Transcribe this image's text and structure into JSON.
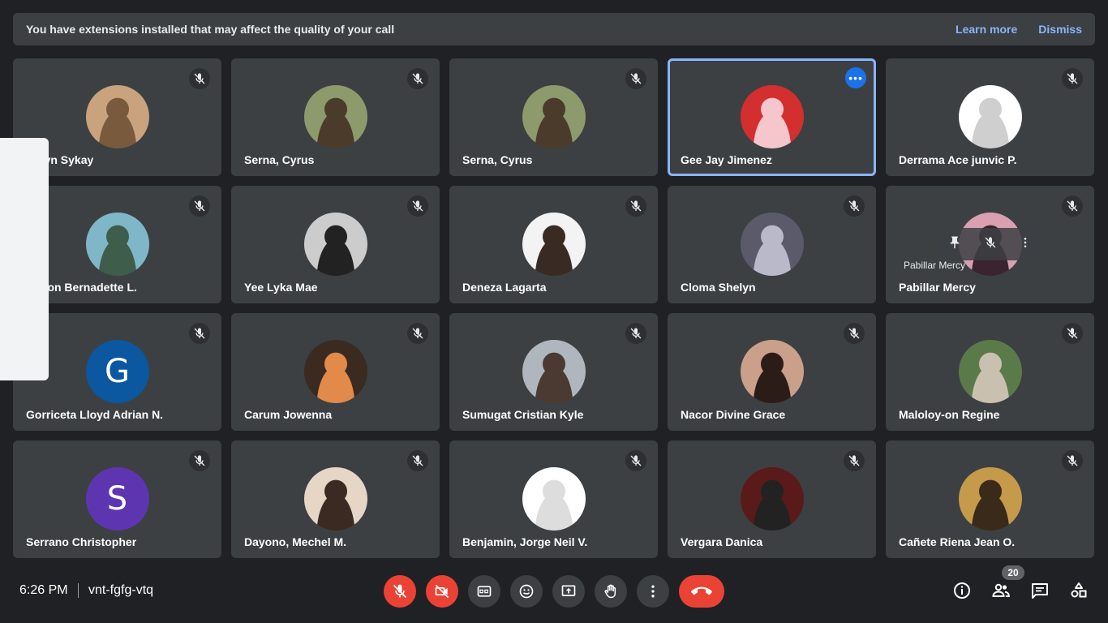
{
  "banner": {
    "message": "You have extensions installed that may affect the quality of your call",
    "learn_more": "Learn more",
    "dismiss": "Dismiss"
  },
  "participants": [
    {
      "name": "Gelyn Sykay",
      "avatar": "photo",
      "muted": true
    },
    {
      "name": "Serna, Cyrus",
      "avatar": "photo",
      "muted": true
    },
    {
      "name": "Serna, Cyrus",
      "avatar": "photo",
      "muted": true
    },
    {
      "name": "Gee Jay Jimenez",
      "avatar": "photo",
      "muted": false,
      "active": true
    },
    {
      "name": "Derrama Ace junvic P.",
      "avatar": "photo",
      "muted": true
    },
    {
      "name": "Forlon Bernadette L.",
      "avatar": "photo",
      "muted": true
    },
    {
      "name": "Yee Lyka Mae",
      "avatar": "photo",
      "muted": true
    },
    {
      "name": "Deneza Lagarta",
      "avatar": "photo",
      "muted": true
    },
    {
      "name": "Cloma Shelyn",
      "avatar": "photo",
      "muted": true
    },
    {
      "name": "Pabillar Mercy",
      "avatar": "photo",
      "muted": true,
      "hover_label": "Pabillar Mercy"
    },
    {
      "name": "Gorriceta Lloyd Adrian N.",
      "avatar": "letter",
      "letter": "G",
      "color": "#0b57a0",
      "muted": true
    },
    {
      "name": "Carum Jowenna",
      "avatar": "photo",
      "muted": true
    },
    {
      "name": "Sumugat Cristian Kyle",
      "avatar": "photo",
      "muted": true
    },
    {
      "name": "Nacor Divine Grace",
      "avatar": "photo",
      "muted": true
    },
    {
      "name": "Maloloy-on Regine",
      "avatar": "photo",
      "muted": true
    },
    {
      "name": "Serrano Christopher",
      "avatar": "letter",
      "letter": "S",
      "color": "#5e35b1",
      "muted": true
    },
    {
      "name": "Dayono, Mechel M.",
      "avatar": "photo",
      "muted": true
    },
    {
      "name": "Benjamin, Jorge Neil V.",
      "avatar": "photo",
      "muted": true
    },
    {
      "name": "Vergara Danica",
      "avatar": "photo",
      "muted": true
    },
    {
      "name": "Cañete Riena Jean O.",
      "avatar": "photo",
      "muted": true
    }
  ],
  "footer": {
    "time": "6:26 PM",
    "meeting_code": "vnt-fgfg-vtq",
    "participant_count": "20"
  },
  "colors": {
    "background": "#202124",
    "tile": "#3c4043",
    "accent": "#8ab4f8",
    "danger": "#ea4335"
  }
}
